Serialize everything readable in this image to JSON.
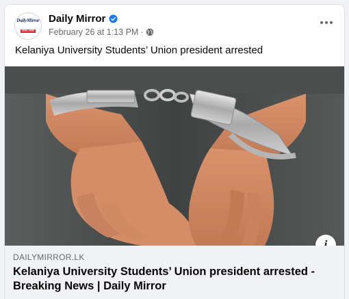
{
  "post": {
    "page_name": "Daily Mirror",
    "verified": true,
    "timestamp": "February 26 at 1:13 PM",
    "separator": "·",
    "audience_icon": "globe-icon",
    "text": "Kelaniya University Students’ Union president arrested"
  },
  "avatar": {
    "logo_line1": "DailyMirror",
    "logo_line2": "ONLINE"
  },
  "link_preview": {
    "domain": "DAILYMIRROR.LK",
    "title": "Kelaniya University Students’ Union president arrested - Breaking News | Daily Mirror"
  },
  "media": {
    "image_subject": "Hands in handcuffs behind back",
    "info_label": "i"
  },
  "colors": {
    "verified_blue": "#1877f2",
    "secondary_text": "#65676b",
    "preview_bg": "#f0f2f5"
  }
}
